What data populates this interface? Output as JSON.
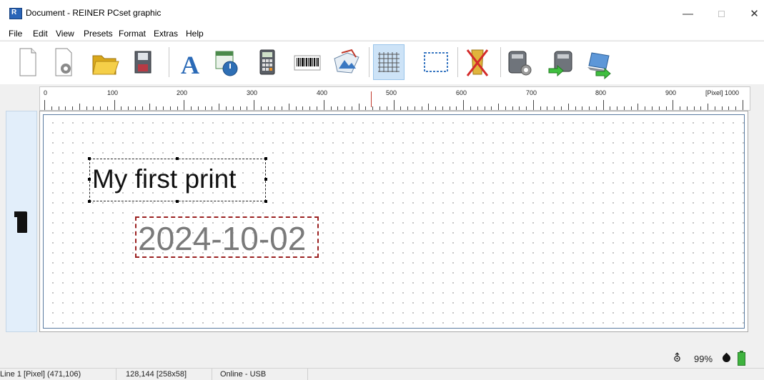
{
  "window": {
    "title": "Document - REINER PCset graphic",
    "minimize": "—",
    "maximize": "☐",
    "close": "✕"
  },
  "menu": [
    "File",
    "Edit",
    "View",
    "Presets",
    "Format",
    "Extras",
    "Help"
  ],
  "toolbar": {
    "buttons": [
      {
        "icon": "new-document-icon"
      },
      {
        "icon": "document-settings-icon"
      },
      {
        "icon": "open-folder-icon"
      },
      {
        "icon": "save-disk-icon"
      },
      {
        "icon": "text-icon"
      },
      {
        "icon": "datetime-icon"
      },
      {
        "icon": "counter-calculator-icon"
      },
      {
        "icon": "barcode-icon"
      },
      {
        "icon": "image-icon"
      },
      {
        "icon": "grid-icon",
        "active": true
      },
      {
        "icon": "frame-icon"
      },
      {
        "icon": "delete-icon"
      },
      {
        "icon": "printer-settings-icon"
      },
      {
        "icon": "printer-transfer-icon"
      },
      {
        "icon": "laptop-transfer-icon"
      }
    ]
  },
  "ruler": {
    "labels": [
      "0",
      "100",
      "200",
      "300",
      "400",
      "500",
      "600",
      "700",
      "800",
      "900"
    ],
    "unit_label": "[Pixel] 1000"
  },
  "canvas": {
    "text_object": "My first print",
    "date_object": "2024-10-02"
  },
  "indicators": {
    "usb": "⛢",
    "ink_level": "99%"
  },
  "statusbar": {
    "line": "Line 1 [Pixel] (471,106)",
    "object": "128,144 [258x58]",
    "connection": "Online - USB"
  },
  "colors": {
    "accent": "#cde3f7",
    "selection": "#9b2020",
    "battery": "#3eb33e"
  }
}
